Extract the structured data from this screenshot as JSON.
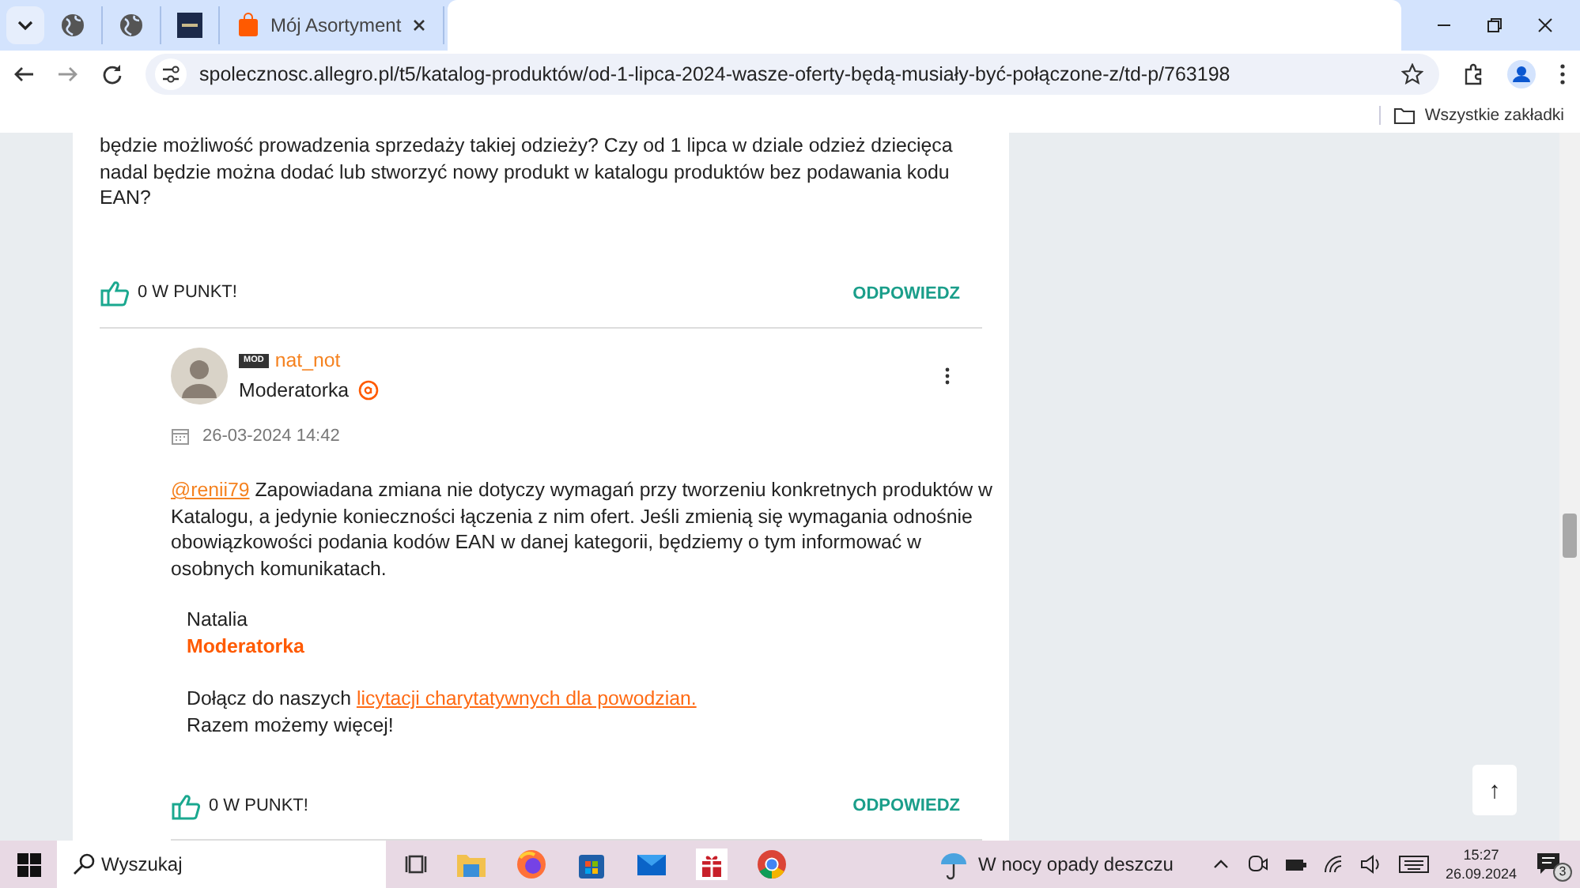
{
  "browser": {
    "tabs": [
      {
        "kind": "globe",
        "selected": false
      },
      {
        "kind": "globe",
        "selected": false
      },
      {
        "kind": "nbp",
        "selected": false
      },
      {
        "kind": "shop",
        "title": "Mój Asortyment",
        "selected": true
      }
    ],
    "address": "spolecznosc.allegro.pl/t5/katalog-produktów/od-1-lipca-2024-wasze-oferty-będą-musiały-być-połączone-z/td-p/763198",
    "bookmarks": "Wszystkie zakładki"
  },
  "posts": [
    {
      "kind": "cut",
      "body": "będzie możliwość prowadzenia sprzedaży takiej odzieży? Czy od 1 lipca w dziale odzież dziecięca nadal będzie można dodać lub stworzyć nowy produkt w katalogu produktów bez podawania kodu EAN?",
      "likes": "0 W PUNKT!",
      "reply": "ODPOWIEDZ"
    },
    {
      "kind": "full",
      "badge": "MOD",
      "author": "nat_not",
      "rank": "Moderatorka",
      "date": "26-03-2024 14:42",
      "mention": "@renii79",
      "body": "Zapowiadana zmiana nie dotyczy wymagań przy tworzeniu konkretnych produktów w Katalogu, a jedynie konieczności łączenia z nim ofert. Jeśli zmienią się wymagania odnośnie obowiązkowości podania kodów EAN w danej kategorii, będziemy o tym informować w osobnych komunikatach.",
      "signature": {
        "name": "Natalia",
        "role": "Moderatorka",
        "lead": "Dołącz do naszych",
        "link": "licytacji charytatywnych dla powodzian.",
        "closing": "Razem możemy więcej!"
      },
      "likes": "0 W PUNKT!",
      "reply": "ODPOWIEDZ"
    }
  ],
  "back_to_top": "↑",
  "taskbar": {
    "search_placeholder": "Wyszukaj",
    "weather": "W nocy opady deszczu",
    "time": "15:27",
    "date": "26.09.2024",
    "notifications": "3"
  }
}
